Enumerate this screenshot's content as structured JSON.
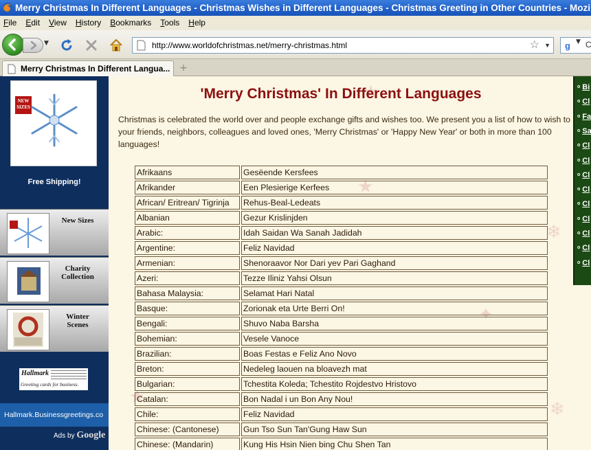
{
  "window": {
    "title": "Merry Christmas In Different Languages - Christmas Wishes in Different Languages - Christmas Greeting in Other Countries - Mozilla Firefox"
  },
  "menu": [
    {
      "label": "File",
      "key": "F",
      "rest": "ile"
    },
    {
      "label": "Edit",
      "key": "E",
      "rest": "dit"
    },
    {
      "label": "View",
      "key": "V",
      "rest": "iew"
    },
    {
      "label": "History",
      "key": "H",
      "rest": "istory"
    },
    {
      "label": "Bookmarks",
      "key": "B",
      "rest": "ookmarks"
    },
    {
      "label": "Tools",
      "key": "T",
      "rest": "ools"
    },
    {
      "label": "Help",
      "key": "H",
      "rest": "elp"
    }
  ],
  "toolbar": {
    "url": "http://www.worldofchristmas.net/merry-christmas.html",
    "search_text": "C"
  },
  "tabs": [
    {
      "label": "Merry Christmas In Different Langua..."
    }
  ],
  "new_tab_symbol": "+",
  "left_ad": {
    "badge": "NEW SIZES",
    "free_shipping": "Free Shipping!",
    "panels": [
      {
        "label": "New Sizes"
      },
      {
        "label": "Charity Collection"
      },
      {
        "label": "Winter Scenes"
      }
    ],
    "hallmark_logo": "Hallmark",
    "hallmark_tagline": "Greeting cards for business.",
    "link_text": "Hallmark.Businessgreetings.co",
    "ads_by": "Ads by",
    "ads_brand": "Google"
  },
  "page": {
    "heading": "'Merry Christmas' In Different Languages",
    "intro": "Christmas is celebrated the world over and people exchange gifts and wishes too. We present you a list of how to wish to your friends, neighbors, colleagues and loved ones, 'Merry Christmas' or 'Happy New Year' or both in more than 100 languages!",
    "rows": [
      {
        "language": "Afrikaans",
        "greeting": "Gesëende Kersfees"
      },
      {
        "language": "Afrikander",
        "greeting": "Een Plesierige Kerfees"
      },
      {
        "language": "African/ Eritrean/ Tigrinja",
        "greeting": "Rehus-Beal-Ledeats"
      },
      {
        "language": "Albanian",
        "greeting": "Gezur Krislinjden"
      },
      {
        "language": "Arabic:",
        "greeting": "Idah Saidan Wa Sanah Jadidah"
      },
      {
        "language": "Argentine:",
        "greeting": "Feliz Navidad"
      },
      {
        "language": "Armenian:",
        "greeting": "Shenoraavor Nor Dari yev Pari Gaghand"
      },
      {
        "language": "Azeri:",
        "greeting": "Tezze Iliniz Yahsi Olsun"
      },
      {
        "language": "Bahasa Malaysia:",
        "greeting": "Selamat Hari Natal"
      },
      {
        "language": "Basque:",
        "greeting": "Zorionak eta Urte Berri On!"
      },
      {
        "language": "Bengali:",
        "greeting": "Shuvo Naba Barsha"
      },
      {
        "language": "Bohemian:",
        "greeting": "Vesele Vanoce"
      },
      {
        "language": "Brazilian:",
        "greeting": "Boas Festas e Feliz Ano Novo"
      },
      {
        "language": "Breton:",
        "greeting": "Nedeleg laouen na bloavezh mat"
      },
      {
        "language": "Bulgarian:",
        "greeting": "Tchestita Koleda; Tchestito Rojdestvo Hristovo"
      },
      {
        "language": "Catalan:",
        "greeting": "Bon Nadal i un Bon Any Nou!"
      },
      {
        "language": "Chile:",
        "greeting": "Feliz Navidad"
      },
      {
        "language": "Chinese: (Cantonese)",
        "greeting": "Gun Tso Sun Tan'Gung Haw Sun"
      },
      {
        "language": "Chinese: (Mandarin)",
        "greeting": "Kung His Hsin Nien bing Chu Shen Tan"
      }
    ]
  },
  "right_nav": [
    {
      "label": "Bi"
    },
    {
      "label": "Cl"
    },
    {
      "label": "Fa"
    },
    {
      "label": "Sa"
    },
    {
      "label": "Cl"
    },
    {
      "label": "Cl"
    },
    {
      "label": "Cl"
    },
    {
      "label": "Cl"
    },
    {
      "label": "Cl"
    },
    {
      "label": "Cl"
    },
    {
      "label": "Cl"
    },
    {
      "label": "Cl"
    },
    {
      "label": "Cl"
    }
  ],
  "right_nav_bullet": "o"
}
